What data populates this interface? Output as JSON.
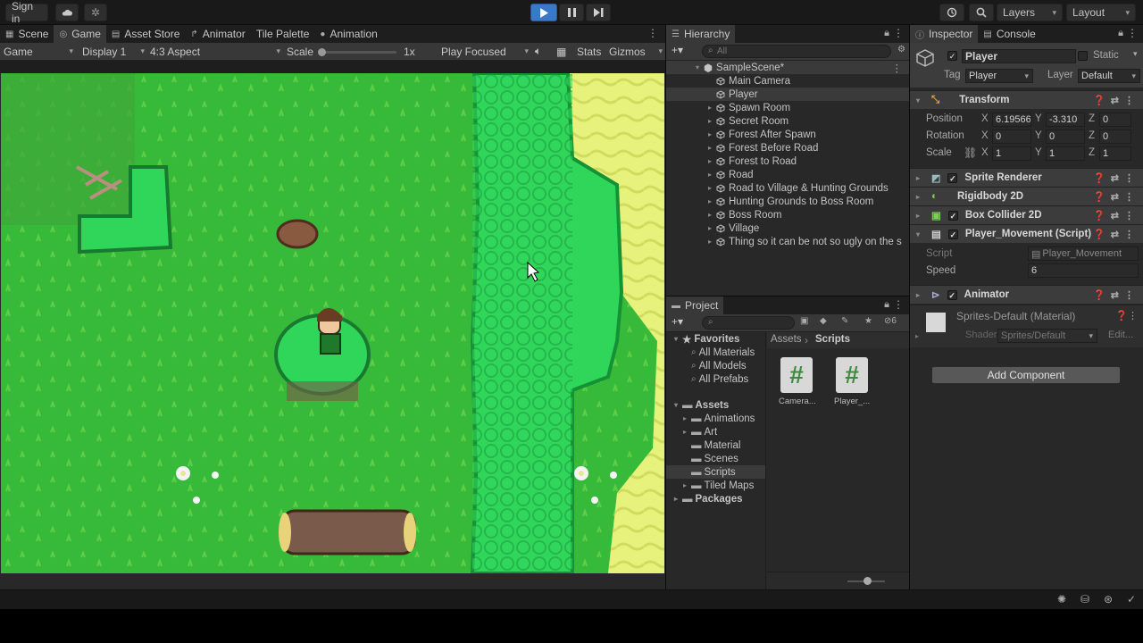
{
  "toolbar": {
    "sign_in": "Sign in",
    "layers": "Layers",
    "layout": "Layout"
  },
  "tabs_left": [
    {
      "label": "Scene",
      "icon": "scene-icon"
    },
    {
      "label": "Game",
      "icon": "game-icon"
    },
    {
      "label": "Asset Store",
      "icon": "store-icon"
    },
    {
      "label": "Animator",
      "icon": "animator-icon"
    },
    {
      "label": "Tile Palette",
      "icon": ""
    },
    {
      "label": "Animation",
      "icon": "animation-icon"
    }
  ],
  "game_toolbar": {
    "mode": "Game",
    "display": "Display 1",
    "aspect": "4:3 Aspect",
    "scale_label": "Scale",
    "scale_value": "1x",
    "play_mode": "Play Focused",
    "stats": "Stats",
    "gizmos": "Gizmos"
  },
  "hierarchy": {
    "tab": "Hierarchy",
    "search_placeholder": "All",
    "scene": "SampleScene*",
    "items": [
      "Main Camera",
      "Player",
      "Spawn Room",
      "Secret Room",
      "Forest After Spawn",
      "Forest Before Road",
      "Forest to Road",
      "Road",
      "Road to Village & Hunting Grounds",
      "Hunting Grounds to Boss Room",
      "Boss Room",
      "Village",
      "Thing so it can be not so ugly on the s"
    ]
  },
  "project": {
    "tab": "Project",
    "hidden_count": "6",
    "favorites_label": "Favorites",
    "favorites": [
      "All Materials",
      "All Models",
      "All Prefabs"
    ],
    "assets_label": "Assets",
    "asset_folders": [
      "Animations",
      "Art",
      "Material",
      "Scenes",
      "Scripts",
      "Tiled Maps"
    ],
    "packages_label": "Packages",
    "breadcrumb": [
      "Assets",
      "Scripts"
    ],
    "files": [
      "Camera...",
      "Player_..."
    ]
  },
  "inspector": {
    "tab": "Inspector",
    "console_tab": "Console",
    "object_name": "Player",
    "static_label": "Static",
    "tag_label": "Tag",
    "tag_value": "Player",
    "layer_label": "Layer",
    "layer_value": "Default",
    "transform": {
      "title": "Transform",
      "position_label": "Position",
      "rotation_label": "Rotation",
      "scale_label": "Scale",
      "position": {
        "x": "6.19566",
        "y": "-3.310",
        "z": "0"
      },
      "rotation": {
        "x": "0",
        "y": "0",
        "z": "0"
      },
      "scale": {
        "x": "1",
        "y": "1",
        "z": "1"
      }
    },
    "components": [
      "Sprite Renderer",
      "Rigidbody 2D",
      "Box Collider 2D",
      "Player_Movement (Script)"
    ],
    "script_label": "Script",
    "script_value": "Player_Movement",
    "speed_label": "Speed",
    "speed_value": "6",
    "animator_title": "Animator",
    "material_name": "Sprites-Default (Material)",
    "shader_label": "Shader",
    "shader_value": "Sprites/Default",
    "edit_label": "Edit...",
    "add_component": "Add Component"
  },
  "axis_labels": {
    "x": "X",
    "y": "Y",
    "z": "Z"
  },
  "colors": {
    "grass": "#37b93a",
    "tree": "#2fd65a",
    "sand": "#e7f27c",
    "accent_play": "#3a78c8"
  }
}
